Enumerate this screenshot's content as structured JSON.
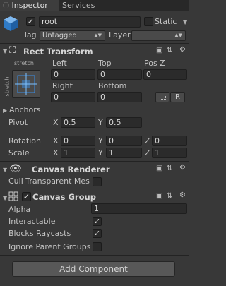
{
  "tabs": [
    {
      "label": "Inspector"
    },
    {
      "label": "Services"
    }
  ],
  "object": {
    "name": "root",
    "active": true,
    "static_label": "Static",
    "tag_label": "Tag",
    "tag_value": "Untagged",
    "layer_label": "Layer",
    "layer_value": ""
  },
  "rect_transform": {
    "title": "Rect Transform",
    "anchor_preset_top": "stretch",
    "anchor_preset_side": "stretch",
    "headers": {
      "left": "Left",
      "top": "Top",
      "posz": "Pos Z",
      "right": "Right",
      "bottom": "Bottom"
    },
    "values": {
      "left": "0",
      "top": "0",
      "posz": "0",
      "right": "0",
      "bottom": "0"
    },
    "raw_edit_button": "R",
    "anchors_label": "Anchors",
    "pivot": {
      "label": "Pivot",
      "x_label": "X",
      "x": "0.5",
      "y_label": "Y",
      "y": "0.5"
    },
    "rotation": {
      "label": "Rotation",
      "x_label": "X",
      "x": "0",
      "y_label": "Y",
      "y": "0",
      "z_label": "Z",
      "z": "0"
    },
    "scale": {
      "label": "Scale",
      "x_label": "X",
      "x": "1",
      "y_label": "Y",
      "y": "1",
      "z_label": "Z",
      "z": "1"
    }
  },
  "canvas_renderer": {
    "title": "Canvas Renderer",
    "cull_label": "Cull Transparent Mesh",
    "cull_checked": false
  },
  "canvas_group": {
    "title": "Canvas Group",
    "enabled": true,
    "alpha_label": "Alpha",
    "alpha_value": "1",
    "interactable_label": "Interactable",
    "interactable_checked": true,
    "blocks_raycasts_label": "Blocks Raycasts",
    "blocks_raycasts_checked": true,
    "ignore_parent_label": "Ignore Parent Groups",
    "ignore_parent_checked": false
  },
  "add_component_label": "Add Component",
  "colors": {
    "background": "#383838",
    "accent_blue": "#3a8ee6",
    "field_bg": "#2b2b2b"
  }
}
